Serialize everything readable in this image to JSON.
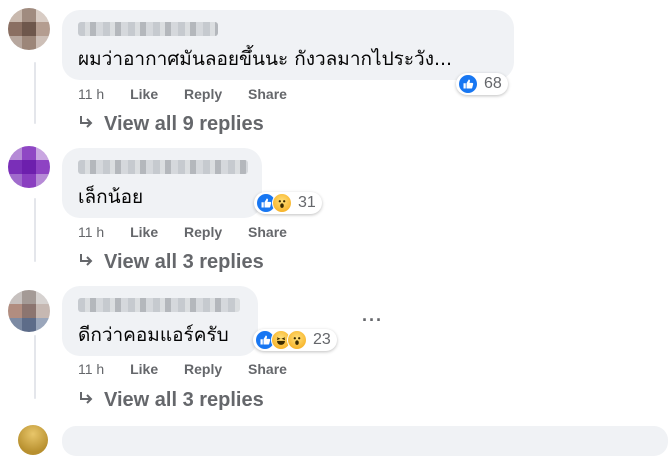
{
  "comments": [
    {
      "text": "ผมว่าอากาศมันลอยขึ้นนะ กังวลมากไประวัง...",
      "reaction_count": "68",
      "reaction_icons": [
        "like-icon"
      ],
      "time": "11 h",
      "like_label": "Like",
      "reply_label": "Reply",
      "share_label": "Share",
      "view_replies": "View all 9 replies"
    },
    {
      "text": "เล็กน้อย",
      "reaction_count": "31",
      "reaction_icons": [
        "like-icon",
        "wow-icon"
      ],
      "time": "11 h",
      "like_label": "Like",
      "reply_label": "Reply",
      "share_label": "Share",
      "view_replies": "View all 3 replies"
    },
    {
      "text": "ดีกว่าคอมแอร์ครับ",
      "reaction_count": "23",
      "reaction_icons": [
        "like-icon",
        "haha-icon",
        "wow-icon"
      ],
      "time": "11 h",
      "like_label": "Like",
      "reply_label": "Reply",
      "share_label": "Share",
      "view_replies": "View all 3 replies",
      "more_options": "···"
    }
  ],
  "colors": {
    "bubble": "#f0f2f5",
    "like_blue": "#1877f2",
    "meta_gray": "#65676b",
    "emoji_yellow": "#f7b125"
  }
}
